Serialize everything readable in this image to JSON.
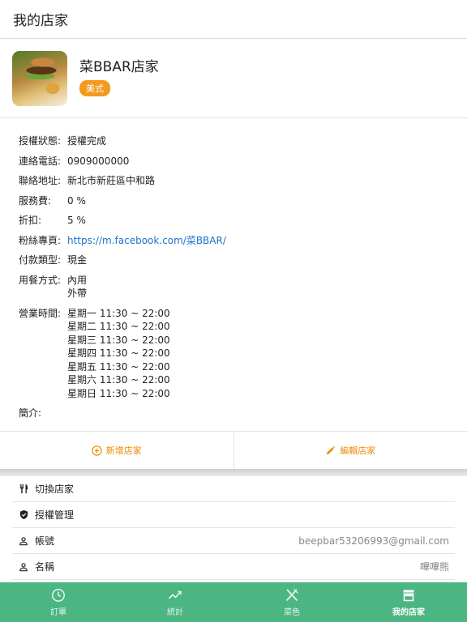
{
  "header": {
    "title": "我的店家"
  },
  "shop": {
    "name": "菜BBAR店家",
    "cuisine": "美式",
    "image_icon": "shop-thumbnail-image"
  },
  "details": {
    "auth_status": {
      "label": "授權狀態:",
      "value": "授權完成"
    },
    "phone": {
      "label": "連絡電話:",
      "value": "0909000000"
    },
    "address": {
      "label": "聯絡地址:",
      "value": "新北市新莊區中和路"
    },
    "service_fee": {
      "label": "服務費:",
      "value": "0 %"
    },
    "discount": {
      "label": "折扣:",
      "value": "5 %"
    },
    "fanpage": {
      "label": "粉絲專頁:",
      "value": "https://m.facebook.com/菜BBAR/"
    },
    "payment": {
      "label": "付款類型:",
      "value": "現金"
    },
    "dining": {
      "label": "用餐方式:",
      "values": [
        "內用",
        "外帶"
      ]
    },
    "hours": {
      "label": "營業時間:",
      "values": [
        "星期一 11:30 ~ 22:00",
        "星期二 11:30 ~ 22:00",
        "星期三 11:30 ~ 22:00",
        "星期四 11:30 ~ 22:00",
        "星期五 11:30 ~ 22:00",
        "星期六 11:30 ~ 22:00",
        "星期日 11:30 ~ 22:00"
      ]
    },
    "intro": {
      "label": "簡介:",
      "value": ""
    }
  },
  "actions": {
    "add": {
      "label": "新增店家",
      "icon": "plus-circle-icon"
    },
    "edit": {
      "label": "編輯店家",
      "icon": "pencil-icon"
    },
    "accent": "#f08a00"
  },
  "menu": [
    {
      "label": "切換店家",
      "value": "",
      "icon": "utensils-icon"
    },
    {
      "label": "授權管理",
      "value": "",
      "icon": "shield-icon"
    },
    {
      "label": "帳號",
      "value": "beepbar53206993@gmail.com",
      "icon": "user-icon"
    },
    {
      "label": "名稱",
      "value": "嗶嗶熊",
      "icon": "user-icon"
    }
  ],
  "tabbar": {
    "color": "#4bb682",
    "tabs": [
      {
        "label": "訂單",
        "icon": "clock-icon",
        "active": false
      },
      {
        "label": "統計",
        "icon": "trend-icon",
        "active": false
      },
      {
        "label": "菜色",
        "icon": "fork-knife-icon",
        "active": false
      },
      {
        "label": "我的店家",
        "icon": "store-icon",
        "active": true
      }
    ]
  }
}
